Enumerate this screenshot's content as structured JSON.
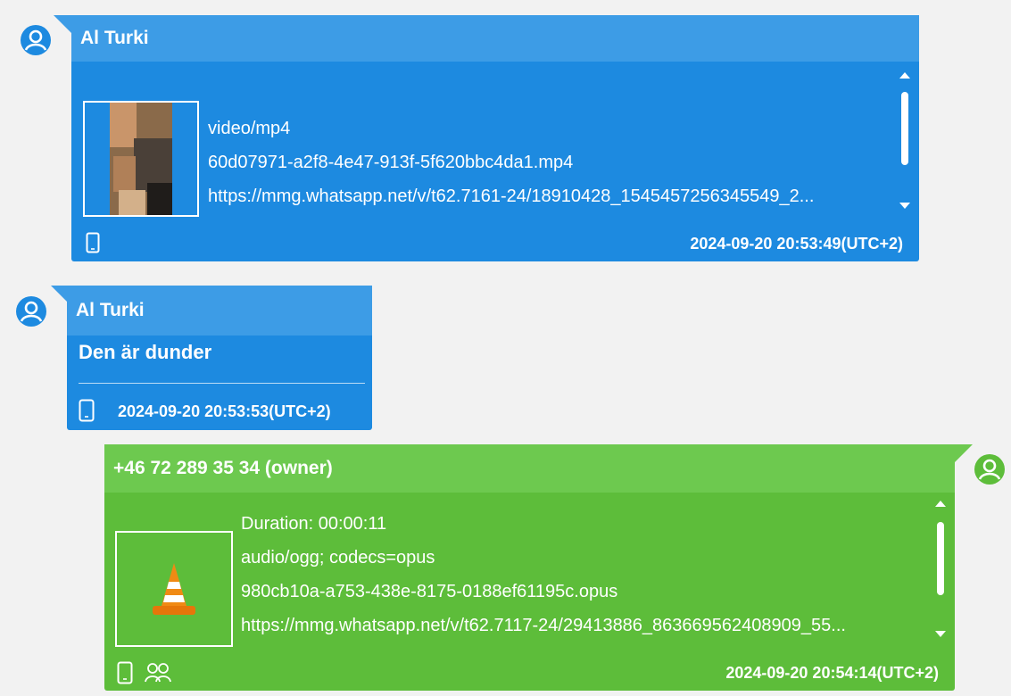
{
  "messages": [
    {
      "sender": "Al Turki",
      "media": {
        "lines": [
          "video/mp4",
          "60d07971-a2f8-4e47-913f-5f620bbc4da1.mp4",
          "https://mmg.whatsapp.net/v/t62.7161-24/18910428_1545457256345549_2..."
        ]
      },
      "timestamp": "2024-09-20 20:53:49(UTC+2)",
      "source_icon": "phone-icon"
    },
    {
      "sender": "Al Turki",
      "text": "Den är dunder",
      "timestamp": "2024-09-20 20:53:53(UTC+2)",
      "source_icon": "phone-icon"
    },
    {
      "sender": "+46 72 289 35 34 (owner)",
      "media": {
        "lines": [
          "Duration: 00:00:11",
          "audio/ogg; codecs=opus",
          "980cb10a-a753-438e-8175-0188ef61195c.opus",
          "https://mmg.whatsapp.net/v/t62.7117-24/29413886_863669562408909_55..."
        ]
      },
      "timestamp": "2024-09-20 20:54:14(UTC+2)",
      "source_icon": "phone-icon",
      "extra_icon": "group-icon"
    }
  ],
  "colors": {
    "incoming": "#1d8ae0",
    "incoming_header": "#3d9ce6",
    "outgoing": "#5dbd3a",
    "outgoing_header": "#6dc94f",
    "background": "#f2f2f2"
  }
}
